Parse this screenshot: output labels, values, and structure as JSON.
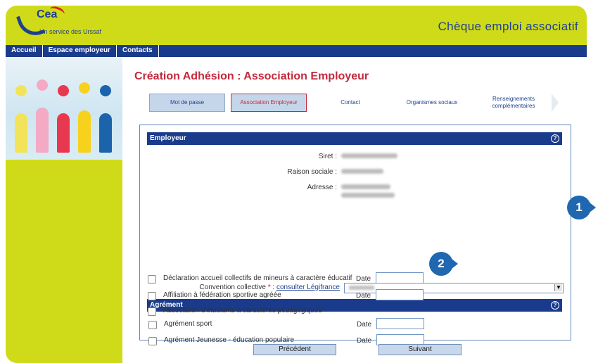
{
  "header": {
    "logo_text": "Cea",
    "logo_subtext": "Un service des Urssaf",
    "app_title": "Chèque emploi associatif"
  },
  "nav": {
    "items": [
      {
        "label": "Accueil"
      },
      {
        "label": "Espace employeur"
      },
      {
        "label": "Contacts"
      }
    ]
  },
  "main": {
    "page_title": "Création Adhésion : Association Employeur",
    "steps": [
      {
        "label": "Mot de passe",
        "state": "done"
      },
      {
        "label": "Association Employeur",
        "state": "active"
      },
      {
        "label": "Contact",
        "state": "todo"
      },
      {
        "label": "Organismes sociaux",
        "state": "todo"
      },
      {
        "label": "Renseignements complémentaires",
        "state": "todo"
      }
    ],
    "employeur": {
      "title": "Employeur",
      "help": "?",
      "siret_label": "Siret :",
      "raison_label": "Raison sociale :",
      "adresse_label": "Adresse :",
      "convention_label": "Convention collective",
      "required_mark": "*",
      "convention_colon": " :",
      "legifrance_link": "consulter Légifrance"
    },
    "agrement": {
      "title": "Agrément",
      "help": "?",
      "items": [
        {
          "label": "Agrément sport",
          "date_label": "Date"
        },
        {
          "label": "Agrément Jeunesse - éducation populaire",
          "date_label": "Date"
        },
        {
          "label": "Déclaration accueil collectifs de mineurs à caractère éducatif",
          "date_label": "Date"
        },
        {
          "label": "Affiliation à fédération sportive agréée",
          "date_label": "Date"
        },
        {
          "label": "Association d'étudiants à caractères pédagogiques"
        }
      ]
    },
    "buttons": {
      "previous": "Précédent",
      "next": "Suivant"
    }
  },
  "annotations": {
    "marker1": "1",
    "marker2": "2"
  },
  "colors": {
    "brand_lime": "#cfdb18",
    "brand_blue": "#1a3b8c",
    "title_red": "#c22a3d",
    "marker_blue": "#1f67b1"
  }
}
